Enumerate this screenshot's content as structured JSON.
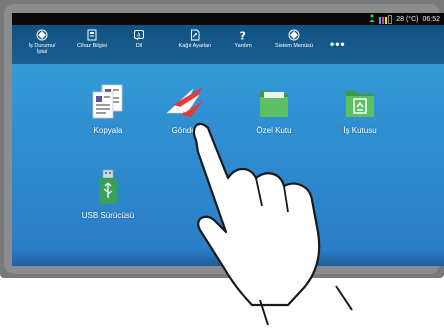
{
  "status": {
    "temperature": "28 (°C)",
    "time": "06:52",
    "toner_colors": [
      "#2bb8e8",
      "#e8368f",
      "#f5e400",
      "#111111"
    ]
  },
  "menu": [
    {
      "label": "İş Durumu/\nİptal",
      "icon": "job-status-icon"
    },
    {
      "label": "Cihaz Bilgisi",
      "icon": "device-info-icon"
    },
    {
      "label": "Dil",
      "icon": "language-icon"
    },
    {
      "label": "Kağıt Ayarları",
      "icon": "paper-settings-icon"
    },
    {
      "label": "Yardım",
      "icon": "help-icon"
    },
    {
      "label": "Sistem Menüsü",
      "icon": "system-menu-icon"
    },
    {
      "label": "•••",
      "icon": "more-icon"
    }
  ],
  "apps": [
    {
      "label": "Kopyala",
      "icon": "copy-icon"
    },
    {
      "label": "Gönder",
      "icon": "send-icon"
    },
    {
      "label": "Özel Kutu",
      "icon": "custom-box-icon"
    },
    {
      "label": "İş Kutusu",
      "icon": "job-box-icon"
    },
    {
      "label": "USB Sürücüsü",
      "icon": "usb-drive-icon"
    }
  ],
  "colors": {
    "screen_top": "#39a2dd",
    "screen_bottom": "#2a7cc6",
    "menubar": "#1a5f93",
    "folder_green": "#4caf50",
    "accent_red": "#e53935"
  }
}
